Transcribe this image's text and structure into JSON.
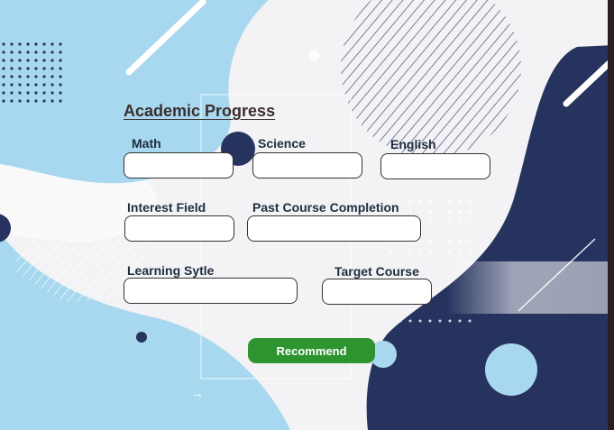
{
  "form": {
    "title": "Academic Progress",
    "fields": {
      "math": {
        "label": "Math",
        "value": ""
      },
      "science": {
        "label": "Science",
        "value": ""
      },
      "english": {
        "label": "English",
        "value": ""
      },
      "interest_field": {
        "label": "Interest Field",
        "value": ""
      },
      "past_course_completion": {
        "label": "Past Course Completion",
        "value": ""
      },
      "learning_style": {
        "label": "Learning Sytle",
        "value": ""
      },
      "target_course": {
        "label": "Target Course",
        "value": ""
      }
    },
    "submit_label": "Recommend"
  },
  "decor": {
    "arrow_glyph": "→",
    "colors": {
      "light_blue": "#a8d8ef",
      "navy": "#26335e",
      "button_green": "#2e9430"
    }
  }
}
